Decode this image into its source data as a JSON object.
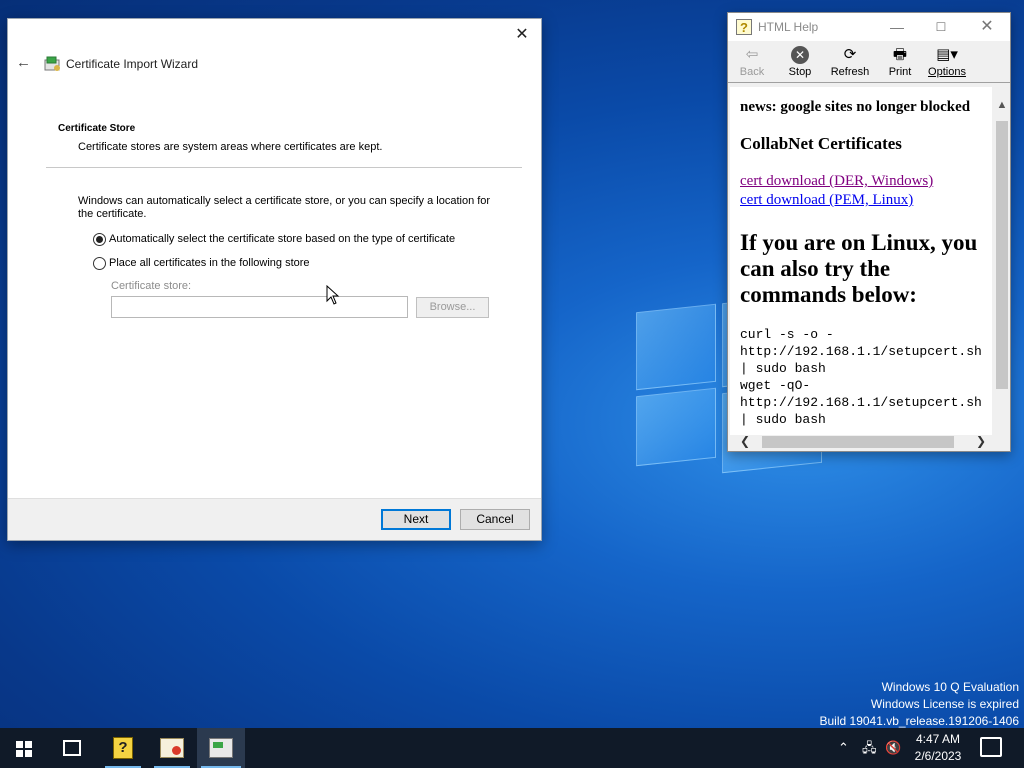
{
  "wizard": {
    "title": "Certificate Import Wizard",
    "section_title": "Certificate Store",
    "section_description": "Certificate stores are system areas where certificates are kept.",
    "intro": "Windows can automatically select a certificate store, or you can specify a location for the certificate.",
    "option_auto": "Automatically select the certificate store based on the type of certificate",
    "option_manual": "Place all certificates in the following store",
    "store_label": "Certificate store:",
    "store_value": "",
    "browse_label": "Browse...",
    "next_label": "Next",
    "cancel_label": "Cancel",
    "selected_option": "auto"
  },
  "help_window": {
    "title": "HTML Help",
    "toolbar": {
      "back": "Back",
      "stop": "Stop",
      "refresh": "Refresh",
      "print": "Print",
      "options": "Options"
    },
    "content": {
      "news": "news: google sites no longer blocked",
      "heading": "CollabNet Certificates",
      "link_der": "cert download (DER, Windows)",
      "link_pem": "cert download (PEM, Linux)",
      "linux_heading": "If you are on Linux, you can also try the commands below:",
      "code": "curl -s -o -\nhttp://192.168.1.1/setupcert.sh\n| sudo bash\nwget -qO-\nhttp://192.168.1.1/setupcert.sh\n| sudo bash"
    }
  },
  "watermark": {
    "line1": "Windows 10 Q Evaluation",
    "line2": "Windows License is expired",
    "line3": "Build 19041.vb_release.191206-1406"
  },
  "taskbar": {
    "time": "4:47 AM",
    "date": "2/6/2023"
  },
  "colors": {
    "accent": "#0078d7",
    "visited_link": "#800080",
    "link": "#0000ee",
    "taskbar": "#101a28"
  }
}
